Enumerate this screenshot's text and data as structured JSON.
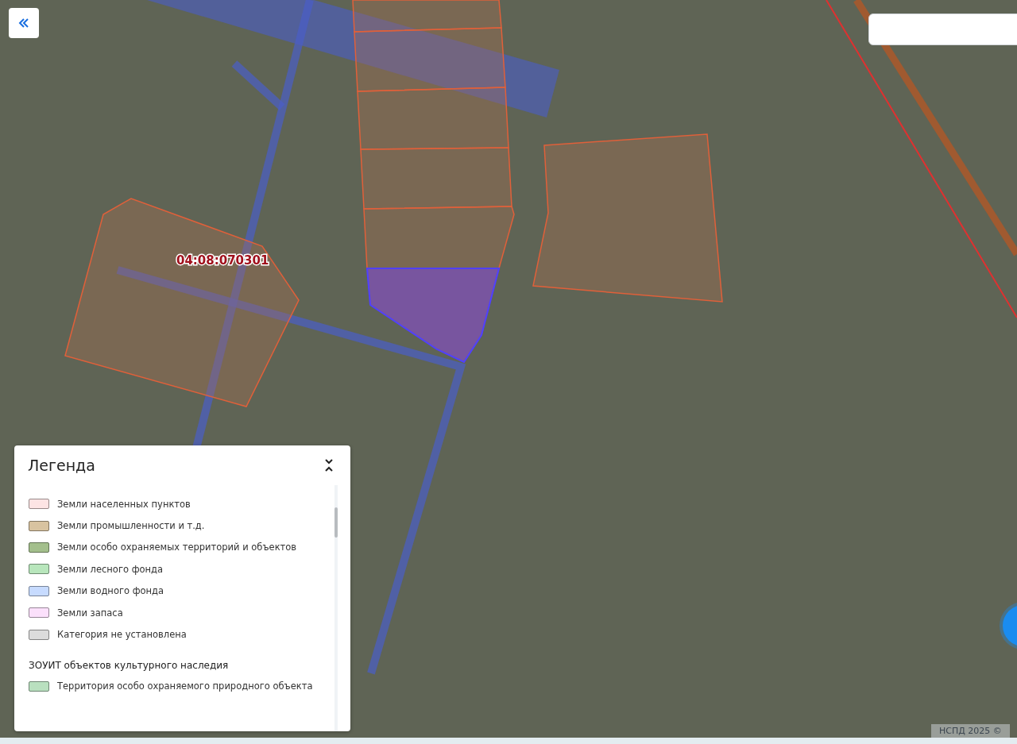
{
  "map": {
    "parcel_label": "04:08:070301",
    "attribution": "НСПД 2025 ©"
  },
  "legend": {
    "title": "Легенда",
    "expanded": true,
    "items": [
      {
        "label": "Земли населенных пунктов",
        "color": "#fde4e4"
      },
      {
        "label": "Земли промышленности и т.д.",
        "color": "#d8c3a0"
      },
      {
        "label": "Земли особо охраняемых территорий и объектов",
        "color": "#a3bf8c"
      },
      {
        "label": "Земли лесного фонда",
        "color": "#b8e6bc"
      },
      {
        "label": "Земли водного фонда",
        "color": "#c7dbff"
      },
      {
        "label": "Земли запаса",
        "color": "#fbe0fb"
      },
      {
        "label": "Категория не установлена",
        "color": "#dcdcdc"
      }
    ],
    "sections": [
      {
        "title": "ЗОУИТ объектов культурного наследия",
        "items": [
          {
            "label": "Территория особо охраняемого природного объекта",
            "color": "#b9e0bf"
          }
        ]
      }
    ]
  }
}
